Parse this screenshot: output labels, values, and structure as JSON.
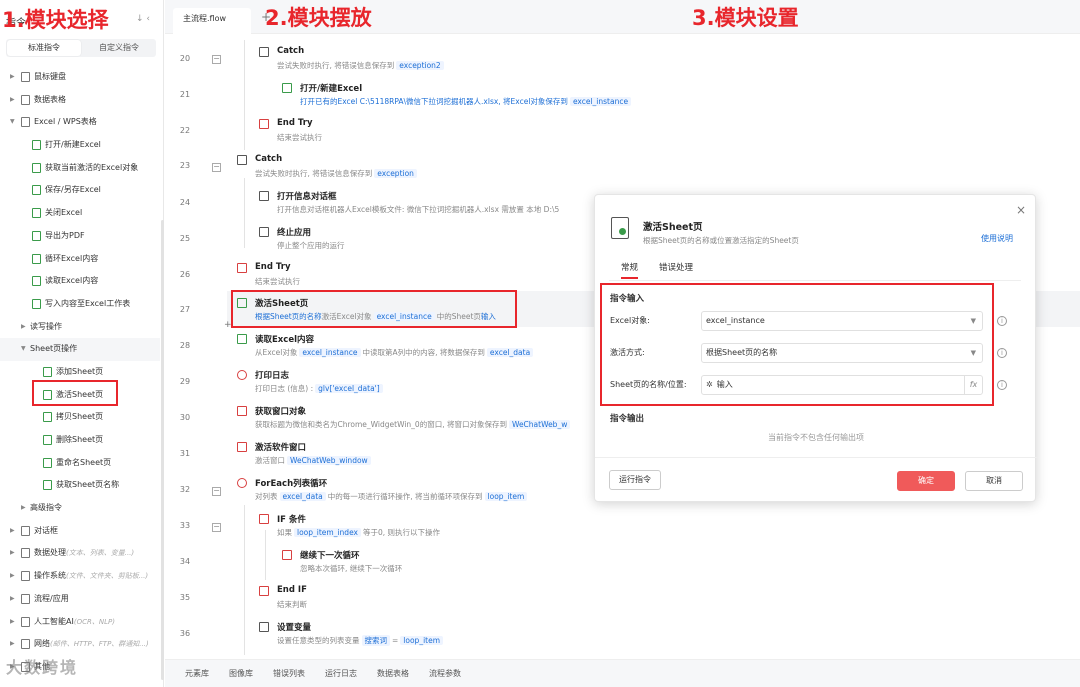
{
  "annotations": {
    "a1": "1.模块选择",
    "a2": "2.模块摆放",
    "a3": "3.模块设置"
  },
  "sidebar": {
    "header": "指令",
    "tabs": [
      "标准指令",
      "自定义指令"
    ],
    "items": [
      {
        "label": "鼠标键盘"
      },
      {
        "label": "数据表格"
      },
      {
        "label": "Excel / WPS表格"
      },
      {
        "label": "打开/新建Excel"
      },
      {
        "label": "获取当前激活的Excel对象"
      },
      {
        "label": "保存/另存Excel"
      },
      {
        "label": "关闭Excel"
      },
      {
        "label": "导出为PDF"
      },
      {
        "label": "循环Excel内容"
      },
      {
        "label": "读取Excel内容"
      },
      {
        "label": "写入内容至Excel工作表"
      },
      {
        "label": "读写操作"
      },
      {
        "label": "Sheet页操作"
      },
      {
        "label": "添加Sheet页"
      },
      {
        "label": "激活Sheet页"
      },
      {
        "label": "拷贝Sheet页"
      },
      {
        "label": "删除Sheet页"
      },
      {
        "label": "重命名Sheet页"
      },
      {
        "label": "获取Sheet页名称"
      },
      {
        "label": "高级指令"
      },
      {
        "label": "对话框"
      },
      {
        "label": "数据处理",
        "hint": "(文本、列表、变量...)"
      },
      {
        "label": "操作系统",
        "hint": "(文件、文件夹、剪贴板...)"
      },
      {
        "label": "流程/应用"
      },
      {
        "label": "人工智能AI",
        "hint": "(OCR、NLP)"
      },
      {
        "label": "网络",
        "hint": "(邮件、HTTP、FTP、群通知...)"
      },
      {
        "label": "其他"
      }
    ]
  },
  "editor": {
    "file_tab": "主流程.flow",
    "file_add": "+",
    "line_numbers": [
      "20",
      "21",
      "22",
      "23",
      "24",
      "25",
      "26",
      "27",
      "28",
      "29",
      "30",
      "31",
      "32",
      "33",
      "34",
      "35",
      "36"
    ],
    "steps": [
      {
        "title": "Catch",
        "desc": "尝试失败时执行, 将错误信息保存到",
        "tag": "exception2"
      },
      {
        "title": "打开/新建Excel",
        "desc": "打开已有的Excel C:\\5118RPA\\微信下拉词挖掘机器人.xlsx, 将Excel对象保存到",
        "tag": "excel_instance"
      },
      {
        "title": "End Try",
        "desc": "结束尝试执行"
      },
      {
        "title": "Catch",
        "desc": "尝试失败时执行, 将错误信息保存到",
        "tag": "exception"
      },
      {
        "title": "打开信息对话框",
        "desc": "打开信息对话框机器人Excel模板文件: 微信下拉词挖掘机器人.xlsx  需放置 本地 D:\\5"
      },
      {
        "title": "终止应用",
        "desc": "停止整个应用的运行"
      },
      {
        "title": "End Try",
        "desc": "结束尝试执行"
      },
      {
        "title": "激活Sheet页",
        "desc_a": "根据Sheet页的名称",
        "desc_b": "激活Excel对象",
        "tag": "excel_instance",
        "desc_c": "中的Sheet页",
        "desc_d": "输入"
      },
      {
        "title": "读取Excel内容",
        "desc": "从Excel对象",
        "tag": "excel_instance",
        "desc2": "中读取第A列中的内容, 将数据保存到",
        "tag2": "excel_data"
      },
      {
        "title": "打印日志",
        "desc": "打印日志 (信息) :",
        "tag": "glv['excel_data']"
      },
      {
        "title": "获取窗口对象",
        "desc": "获取标题为微信和类名为Chrome_WidgetWin_0的窗口, 将窗口对象保存到",
        "tag": "WeChatWeb_w"
      },
      {
        "title": "激活软件窗口",
        "desc": "激活窗口",
        "tag": "WeChatWeb_window"
      },
      {
        "title": "ForEach列表循环",
        "desc": "对列表",
        "tag": "excel_data",
        "desc2": "中的每一项进行循环操作, 将当前循环项保存到",
        "tag2": "loop_item"
      },
      {
        "title": "IF 条件",
        "desc": "如果",
        "tag": "loop_item_index",
        "desc2": "等于0, 则执行以下操作"
      },
      {
        "title": "继续下一次循环",
        "desc": "忽略本次循环, 继续下一次循环"
      },
      {
        "title": "End IF",
        "desc": "结束判断"
      },
      {
        "title": "设置变量",
        "desc": "设置任意类型的列表变量",
        "tag": "搜索词",
        "desc2": "=",
        "tag2": "loop_item"
      }
    ],
    "bottom_tabs": [
      "元素库",
      "图像库",
      "错误列表",
      "运行日志",
      "数据表格",
      "流程参数"
    ]
  },
  "dialog": {
    "title": "激活Sheet页",
    "subtitle": "根据Sheet页的名称或位置激活指定的Sheet页",
    "help": "使用说明",
    "tabs": [
      "常规",
      "错误处理"
    ],
    "input_section": "指令输入",
    "fields": [
      {
        "label": "Excel对象:",
        "value": "excel_instance"
      },
      {
        "label": "激活方式:",
        "value": "根据Sheet页的名称"
      },
      {
        "label": "Sheet页的名称/位置:",
        "value": "输入"
      }
    ],
    "output_section": "指令输出",
    "no_output": "当前指令不包含任何输出项",
    "run_button": "运行指令",
    "ok_button": "确定",
    "cancel_button": "取消",
    "close": "×"
  },
  "watermark": "大数跨境",
  "colors": {
    "annotation_red": "#e8262c",
    "link_blue": "#1d6fd6",
    "confirm_red": "#f05a5a"
  }
}
